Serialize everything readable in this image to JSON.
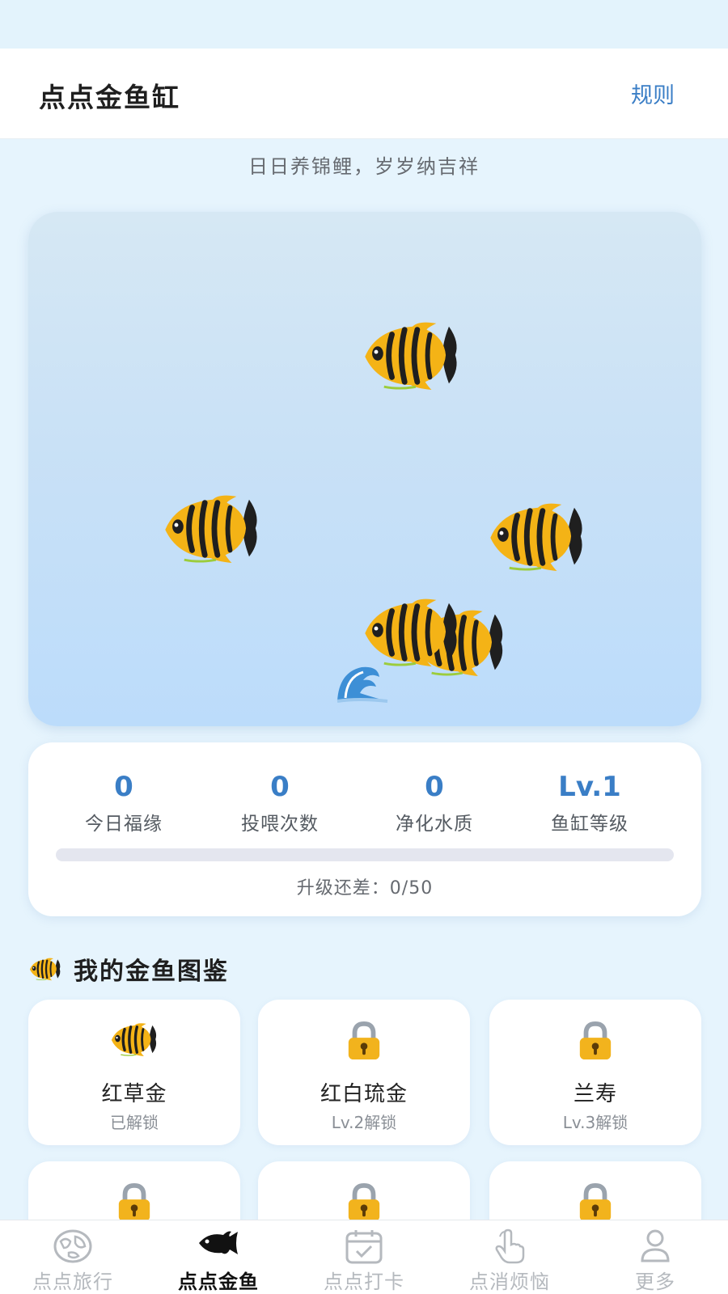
{
  "header": {
    "title": "点点金鱼缸",
    "rules_label": "规则"
  },
  "slogan": "日日养锦鲤，岁岁纳吉祥",
  "tank": {
    "fish_count": 5,
    "fish_icon": "butterflyfish-icon",
    "wave_icon": "wave-icon"
  },
  "stats": [
    {
      "value": "0",
      "label": "今日福缘"
    },
    {
      "value": "0",
      "label": "投喂次数"
    },
    {
      "value": "0",
      "label": "净化水质"
    },
    {
      "value": "Lv.1",
      "label": "鱼缸等级"
    }
  ],
  "progress": {
    "text": "升级还差：0/50",
    "fraction": 0
  },
  "collection": {
    "title": "我的金鱼图鉴",
    "items": [
      {
        "name": "红草金",
        "status": "已解锁",
        "icon": "fish-icon"
      },
      {
        "name": "红白琉金",
        "status": "Lv.2解锁",
        "icon": "lock-icon"
      },
      {
        "name": "兰寿",
        "status": "Lv.3解锁",
        "icon": "lock-icon"
      },
      {
        "icon": "lock-icon"
      },
      {
        "icon": "lock-icon"
      },
      {
        "icon": "lock-icon"
      }
    ]
  },
  "tabs": [
    {
      "label": "点点旅行",
      "icon": "map-icon",
      "active": false
    },
    {
      "label": "点点金鱼",
      "icon": "fish-icon",
      "active": true
    },
    {
      "label": "点点打卡",
      "icon": "calendar-check-icon",
      "active": false
    },
    {
      "label": "点消烦恼",
      "icon": "tap-hand-icon",
      "active": false
    },
    {
      "label": "更多",
      "icon": "user-icon",
      "active": false
    }
  ],
  "colors": {
    "accent": "#3a7ec6",
    "background": "#e6f4fd",
    "fish_yellow": "#f4b316",
    "lock_gold": "#f2b31d"
  }
}
